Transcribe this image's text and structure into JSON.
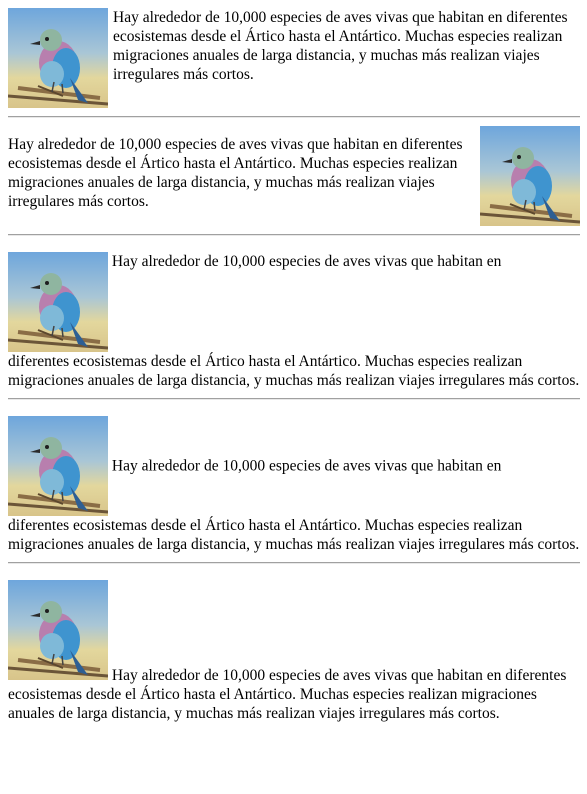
{
  "paragraph_text": "Hay alrededor de 10,000 especies de aves vivas que habitan en diferentes ecosistemas desde el Ártico hasta el Antártico. Muchas especies realizan migraciones anuales de larga distancia, y muchas más realizan viajes irregulares más cortos.",
  "paragraph_part1": "Hay alrededor de 10,000 especies de aves vivas que habitan en",
  "paragraph_part2": "diferentes ecosistemas desde el Ártico hasta el Antártico. Muchas especies realizan migraciones anuales de larga distancia, y muchas más realizan viajes irregulares más cortos.",
  "image_subject": "lilac-breasted-roller-bird",
  "colors": {
    "sky": "#7eaee0",
    "ground": "#d9c98e",
    "bird_blue": "#3b8fc9",
    "bird_lilac": "#b07aa6",
    "divider": "#a0a0a0"
  }
}
